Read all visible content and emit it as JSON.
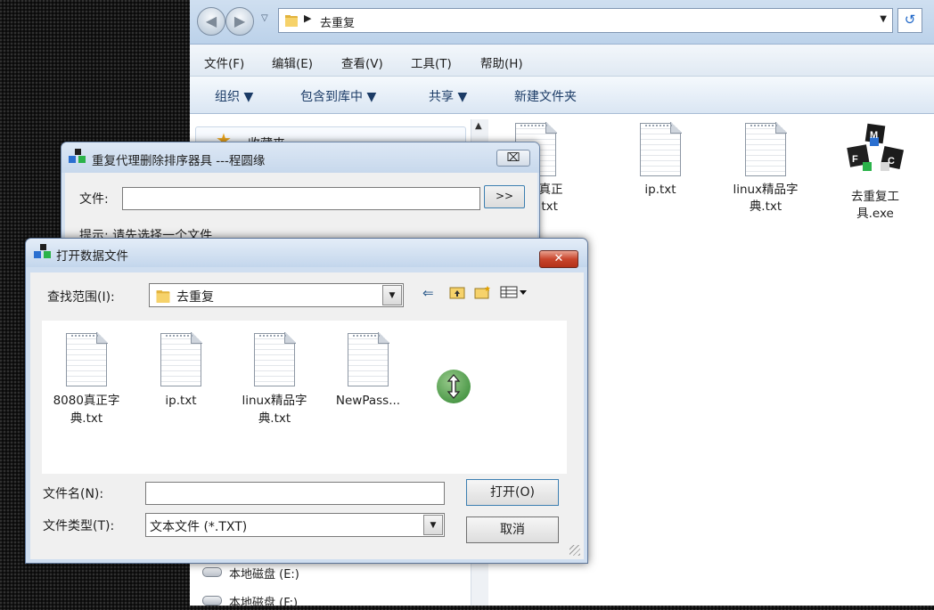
{
  "explorer": {
    "address": {
      "path": "去重复"
    },
    "menu": [
      "文件(F)",
      "编辑(E)",
      "查看(V)",
      "工具(T)",
      "帮助(H)"
    ],
    "toolbar": [
      "组织 ▼",
      "包含到库中 ▼",
      "共享 ▼",
      "新建文件夹"
    ],
    "nav": {
      "favorites": "收藏夹",
      "drives": [
        "本地磁盘 (E:)",
        "本地磁盘 (F:)"
      ]
    },
    "files": [
      {
        "name": "8080真正字典.txt",
        "line1": "8080真正",
        "line2": "字典.txt",
        "icon": "text-file-icon"
      },
      {
        "name": "ip.txt",
        "line1": "ip.txt",
        "line2": "",
        "icon": "text-file-icon"
      },
      {
        "name": "linux精品字典.txt",
        "line1": "linux精品字",
        "line2": "典.txt",
        "icon": "text-file-icon"
      },
      {
        "name": "去重复工具.exe",
        "line1": "去重复工",
        "line2": "具.exe",
        "icon": "mfc-app-icon"
      }
    ]
  },
  "dedup_dialog": {
    "title": "重复代理删除排序器具 ---程圆缘",
    "close": "⌧",
    "file_label": "文件:",
    "file_value": "",
    "browse": ">>",
    "hint": "提示: 请先选择一个文件"
  },
  "open_dialog": {
    "title": "打开数据文件",
    "close": "✕",
    "look_in_label": "查找范围(I):",
    "look_in_value": "去重复",
    "files": [
      {
        "line1": "8080真正字",
        "line2": "典.txt"
      },
      {
        "line1": "ip.txt",
        "line2": ""
      },
      {
        "line1": "linux精品字",
        "line2": "典.txt"
      },
      {
        "line1": "NewPass...",
        "line2": ""
      }
    ],
    "filename_label": "文件名(N):",
    "filename_value": "",
    "filetype_label": "文件类型(T):",
    "filetype_value": "文本文件 (*.TXT)",
    "open_button": "打开(O)",
    "cancel_button": "取消"
  },
  "colors": {
    "accent": "#3c7fb1",
    "titlebar": "#c7d8ec",
    "close_red": "#c8452c"
  }
}
